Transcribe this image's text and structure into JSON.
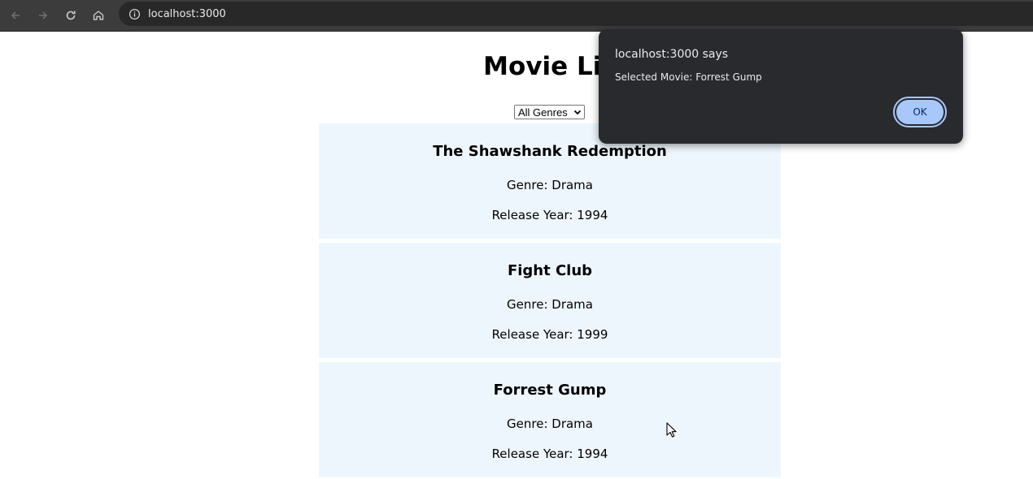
{
  "browser": {
    "url": "localhost:3000",
    "icons": [
      "back-icon",
      "forward-icon",
      "reload-icon",
      "home-icon",
      "info-icon"
    ]
  },
  "page": {
    "title": "Movie Lis",
    "genre_filter": {
      "selected": "All Genres"
    },
    "movies": [
      {
        "title": "The Shawshank Redemption",
        "genre": "Genre: Drama",
        "year": "Release Year: 1994"
      },
      {
        "title": "Fight Club",
        "genre": "Genre: Drama",
        "year": "Release Year: 1999"
      },
      {
        "title": "Forrest Gump",
        "genre": "Genre: Drama",
        "year": "Release Year: 1994"
      }
    ],
    "card_color": "#eef6fd"
  },
  "alert": {
    "origin": "localhost:3000 says",
    "message": "Selected Movie: Forrest Gump",
    "ok_label": "OK",
    "background": "#292a2d",
    "button_color": "#a8c7fa"
  }
}
